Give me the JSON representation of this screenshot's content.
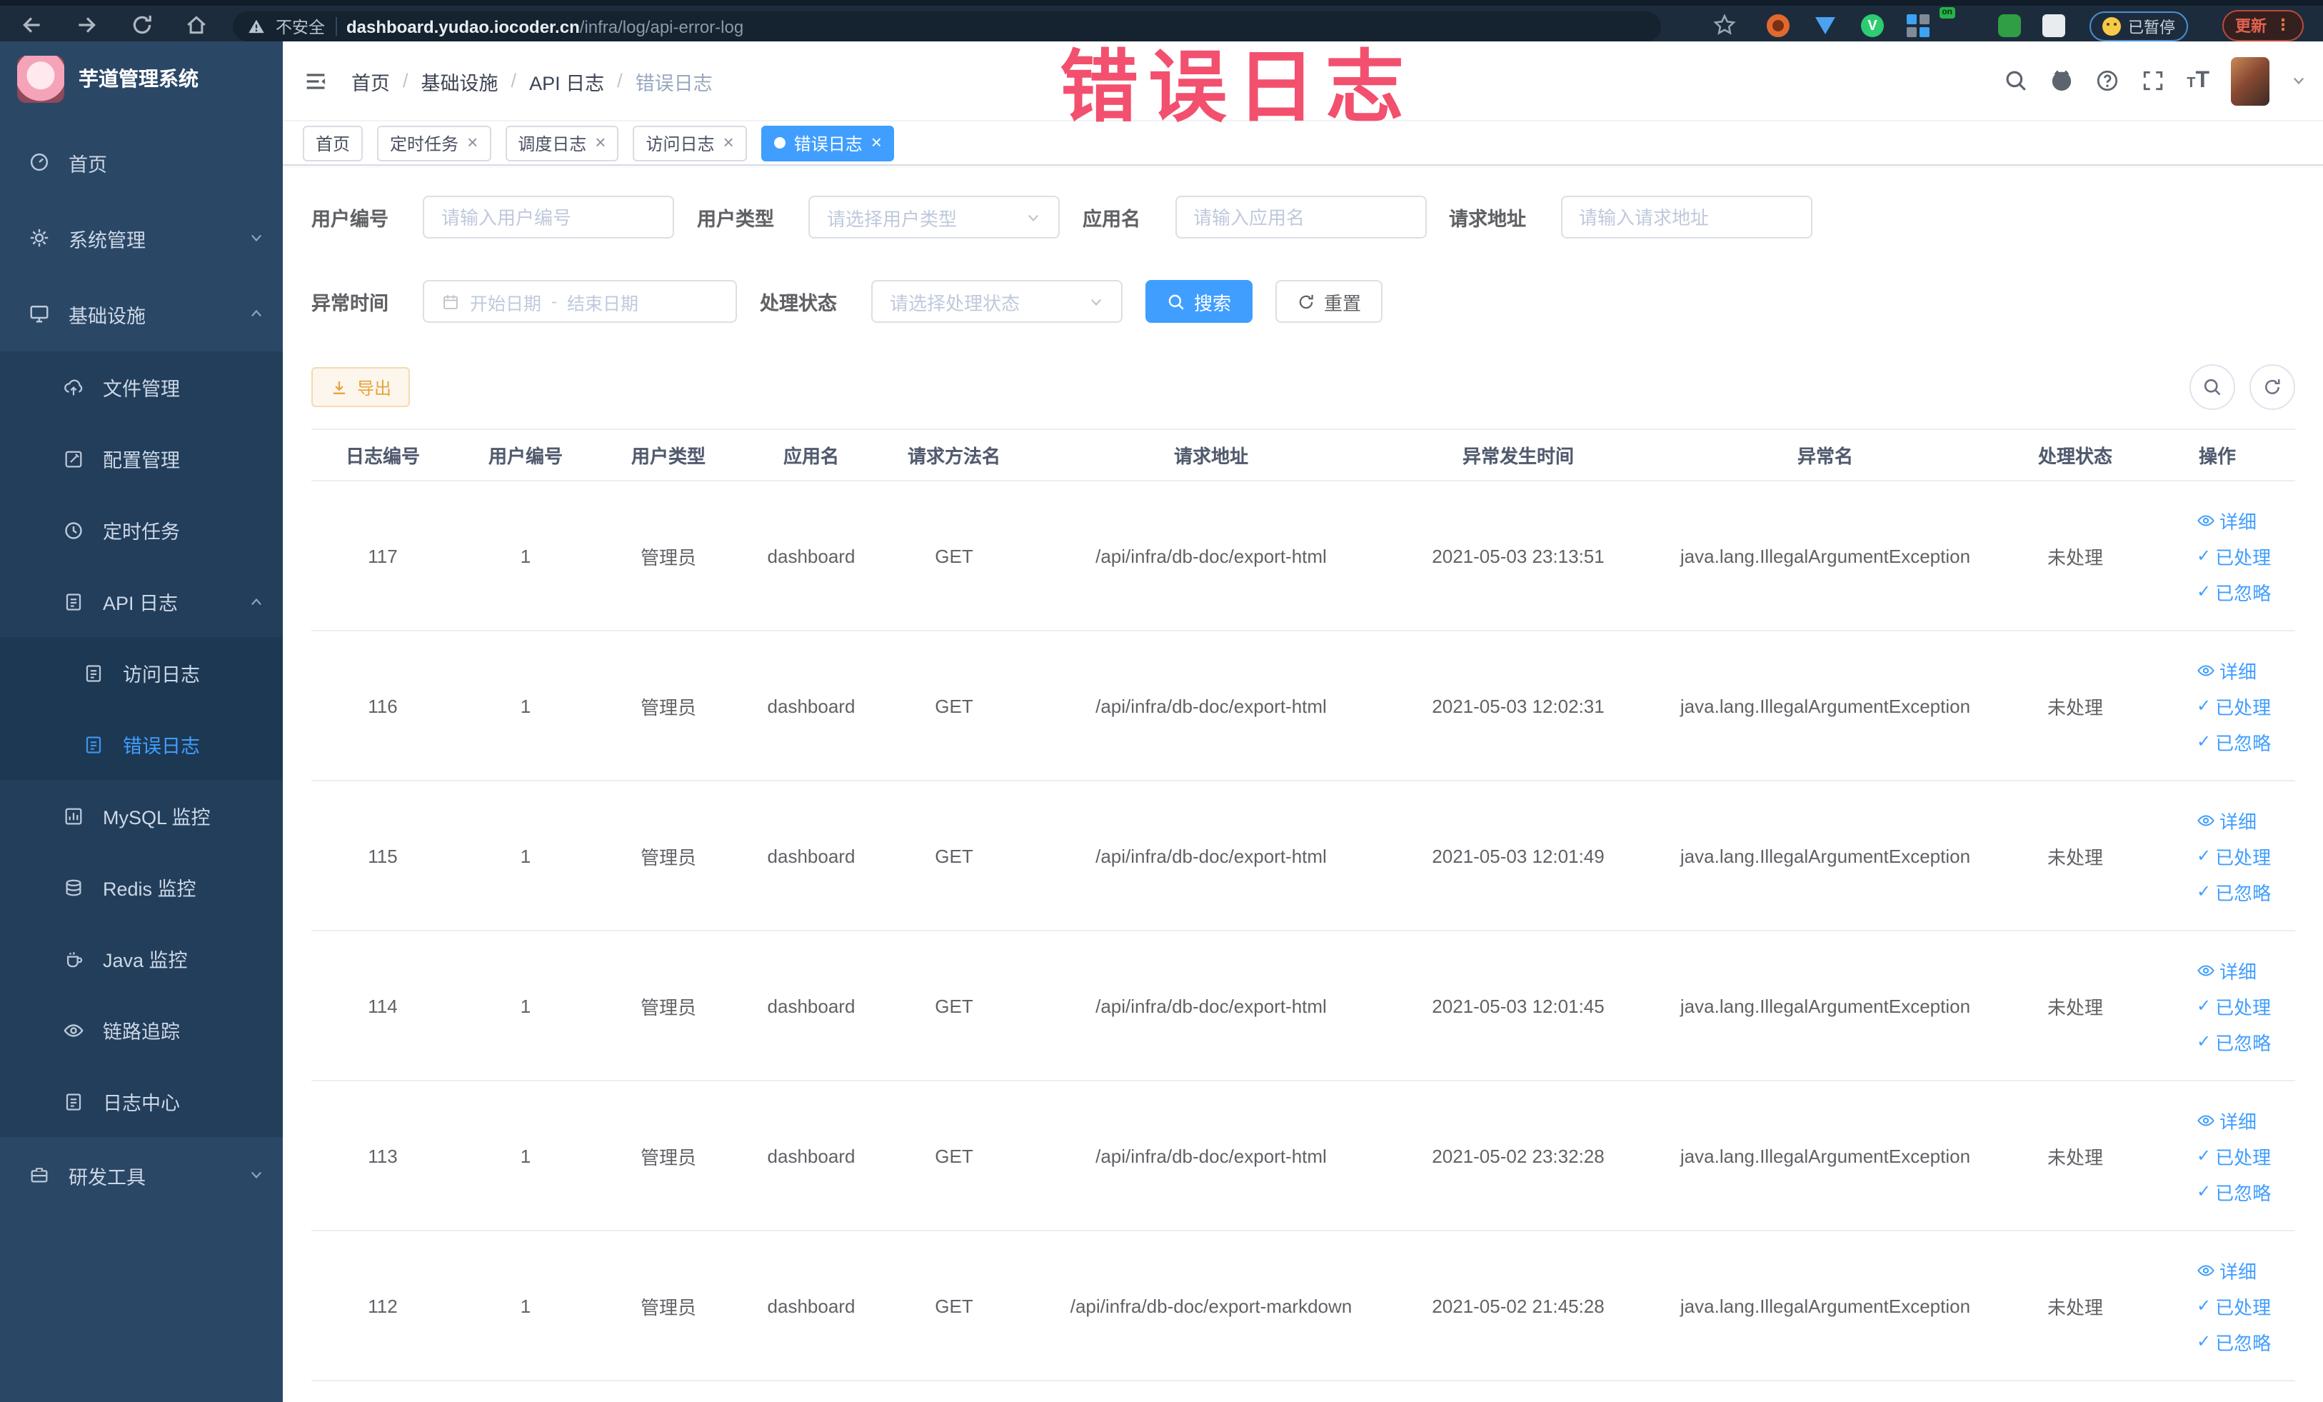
{
  "theme": {
    "accent": "#409eff",
    "annotation_red": "#f2506e",
    "warning_text": "#e6a23c",
    "warning_bg": "#fdf6ec",
    "warning_border": "#f5dab1",
    "sidebar_bg": "#2a4766",
    "sidebar_submenu_bg": "#223e5b",
    "sidebar_nested_bg": "#1d3853",
    "sidebar_text": "#cdd8e6",
    "browser_bar_bg": "#1d2c3d",
    "browser_pill_bg": "#15222f",
    "tab_text": "#495060",
    "table_header_text": "#515a6e",
    "body_text": "#606266",
    "border_light": "#ebeef5",
    "update_red": "#e0604e"
  },
  "browser": {
    "security_label": "不安全",
    "url_host": "dashboard.yudao.iocoder.cn",
    "url_path": "/infra/log/api-error-log",
    "paused_label": "已暂停",
    "update_label": "更新",
    "vue_badge": "V",
    "on_badge": "on",
    "nav_icons": [
      "back",
      "forward",
      "reload",
      "home"
    ],
    "extension_icons": [
      "bookmark-star",
      "orange-extension",
      "shield-extension",
      "vue-devtools",
      "grid-extension",
      "switch-on-extension",
      "leaf-extension",
      "extensions-puzzle"
    ]
  },
  "annotation": {
    "text": "错误日志"
  },
  "sidebar": {
    "logo_title": "芋道管理系统",
    "items": [
      {
        "label": "首页",
        "icon": "dashboard"
      },
      {
        "label": "系统管理",
        "icon": "gear",
        "expand": "down"
      },
      {
        "label": "基础设施",
        "icon": "monitor",
        "expand": "up"
      },
      {
        "label": "文件管理",
        "icon": "cloud-upload"
      },
      {
        "label": "配置管理",
        "icon": "edit"
      },
      {
        "label": "定时任务",
        "icon": "clock"
      },
      {
        "label": "API 日志",
        "icon": "log",
        "expand": "up"
      },
      {
        "label": "访问日志",
        "icon": "log"
      },
      {
        "label": "错误日志",
        "icon": "log",
        "active": true
      },
      {
        "label": "MySQL 监控",
        "icon": "chart"
      },
      {
        "label": "Redis 监控",
        "icon": "database"
      },
      {
        "label": "Java 监控",
        "icon": "coffee"
      },
      {
        "label": "链路追踪",
        "icon": "eye"
      },
      {
        "label": "日志中心",
        "icon": "log"
      },
      {
        "label": "研发工具",
        "icon": "toolbox",
        "expand": "down"
      }
    ]
  },
  "header": {
    "breadcrumb": [
      "首页",
      "基础设施",
      "API 日志",
      "错误日志"
    ],
    "right_icons": [
      "search",
      "github",
      "help",
      "fullscreen",
      "font-size",
      "avatar",
      "caret-down"
    ]
  },
  "tabs": [
    {
      "label": "首页",
      "closable": false,
      "active": false
    },
    {
      "label": "定时任务",
      "closable": true,
      "active": false
    },
    {
      "label": "调度日志",
      "closable": true,
      "active": false
    },
    {
      "label": "访问日志",
      "closable": true,
      "active": false
    },
    {
      "label": "错误日志",
      "closable": true,
      "active": true
    }
  ],
  "filters": {
    "user_id": {
      "label": "用户编号",
      "placeholder": "请输入用户编号"
    },
    "user_type": {
      "label": "用户类型",
      "placeholder": "请选择用户类型"
    },
    "app_name": {
      "label": "应用名",
      "placeholder": "请输入应用名"
    },
    "request_url": {
      "label": "请求地址",
      "placeholder": "请输入请求地址"
    },
    "exception_time": {
      "label": "异常时间",
      "start_placeholder": "开始日期",
      "separator": "-",
      "end_placeholder": "结束日期"
    },
    "process_status": {
      "label": "处理状态",
      "placeholder": "请选择处理状态"
    },
    "search_label": "搜索",
    "reset_label": "重置"
  },
  "toolbar": {
    "export_label": "导出"
  },
  "table": {
    "columns": [
      "日志编号",
      "用户编号",
      "用户类型",
      "应用名",
      "请求方法名",
      "请求地址",
      "异常发生时间",
      "异常名",
      "处理状态",
      "操作"
    ],
    "action_detail_label": "详细",
    "action_processed_label": "已处理",
    "action_ignored_label": "已忽略",
    "rows": [
      {
        "id": "117",
        "user_id": "1",
        "user_type": "管理员",
        "app": "dashboard",
        "method": "GET",
        "url": "/api/infra/db-doc/export-html",
        "time": "2021-05-03 23:13:51",
        "exception": "java.lang.IllegalArgumentException",
        "status": "未处理"
      },
      {
        "id": "116",
        "user_id": "1",
        "user_type": "管理员",
        "app": "dashboard",
        "method": "GET",
        "url": "/api/infra/db-doc/export-html",
        "time": "2021-05-03 12:02:31",
        "exception": "java.lang.IllegalArgumentException",
        "status": "未处理"
      },
      {
        "id": "115",
        "user_id": "1",
        "user_type": "管理员",
        "app": "dashboard",
        "method": "GET",
        "url": "/api/infra/db-doc/export-html",
        "time": "2021-05-03 12:01:49",
        "exception": "java.lang.IllegalArgumentException",
        "status": "未处理"
      },
      {
        "id": "114",
        "user_id": "1",
        "user_type": "管理员",
        "app": "dashboard",
        "method": "GET",
        "url": "/api/infra/db-doc/export-html",
        "time": "2021-05-03 12:01:45",
        "exception": "java.lang.IllegalArgumentException",
        "status": "未处理"
      },
      {
        "id": "113",
        "user_id": "1",
        "user_type": "管理员",
        "app": "dashboard",
        "method": "GET",
        "url": "/api/infra/db-doc/export-html",
        "time": "2021-05-02 23:32:28",
        "exception": "java.lang.IllegalArgumentException",
        "status": "未处理"
      },
      {
        "id": "112",
        "user_id": "1",
        "user_type": "管理员",
        "app": "dashboard",
        "method": "GET",
        "url": "/api/infra/db-doc/export-markdown",
        "time": "2021-05-02 21:45:28",
        "exception": "java.lang.IllegalArgumentException",
        "status": "未处理"
      }
    ]
  }
}
